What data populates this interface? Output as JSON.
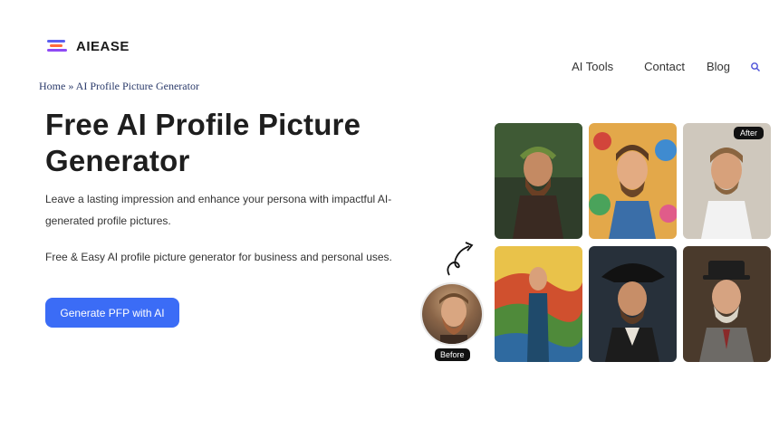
{
  "brand": {
    "name": "AIEASE"
  },
  "nav": {
    "items": [
      {
        "label": "AI Tools"
      },
      {
        "label": "Contact"
      },
      {
        "label": "Blog"
      }
    ],
    "search_icon": "search-icon"
  },
  "breadcrumb": {
    "home": "Home",
    "separator": " » ",
    "current": "AI Profile Picture Generator"
  },
  "hero": {
    "title": "Free AI Profile Picture Generator",
    "description": "Leave a lasting impression and enhance your persona with impactful AI-generated profile pictures.",
    "subtext": "Free & Easy AI profile picture generator for business and personal uses.",
    "cta_label": "Generate PFP with AI"
  },
  "showcase": {
    "before_label": "Before",
    "after_label": "After",
    "tiles": [
      {
        "style": "fantasy-warrior-portrait"
      },
      {
        "style": "illustrated-cartoon-portrait"
      },
      {
        "style": "professional-headshot-portrait"
      },
      {
        "style": "painted-landscape-portrait"
      },
      {
        "style": "pirate-captain-portrait"
      },
      {
        "style": "victorian-gentleman-portrait"
      }
    ]
  },
  "colors": {
    "accent": "#3b6cf6",
    "badge_bg": "#111111"
  }
}
